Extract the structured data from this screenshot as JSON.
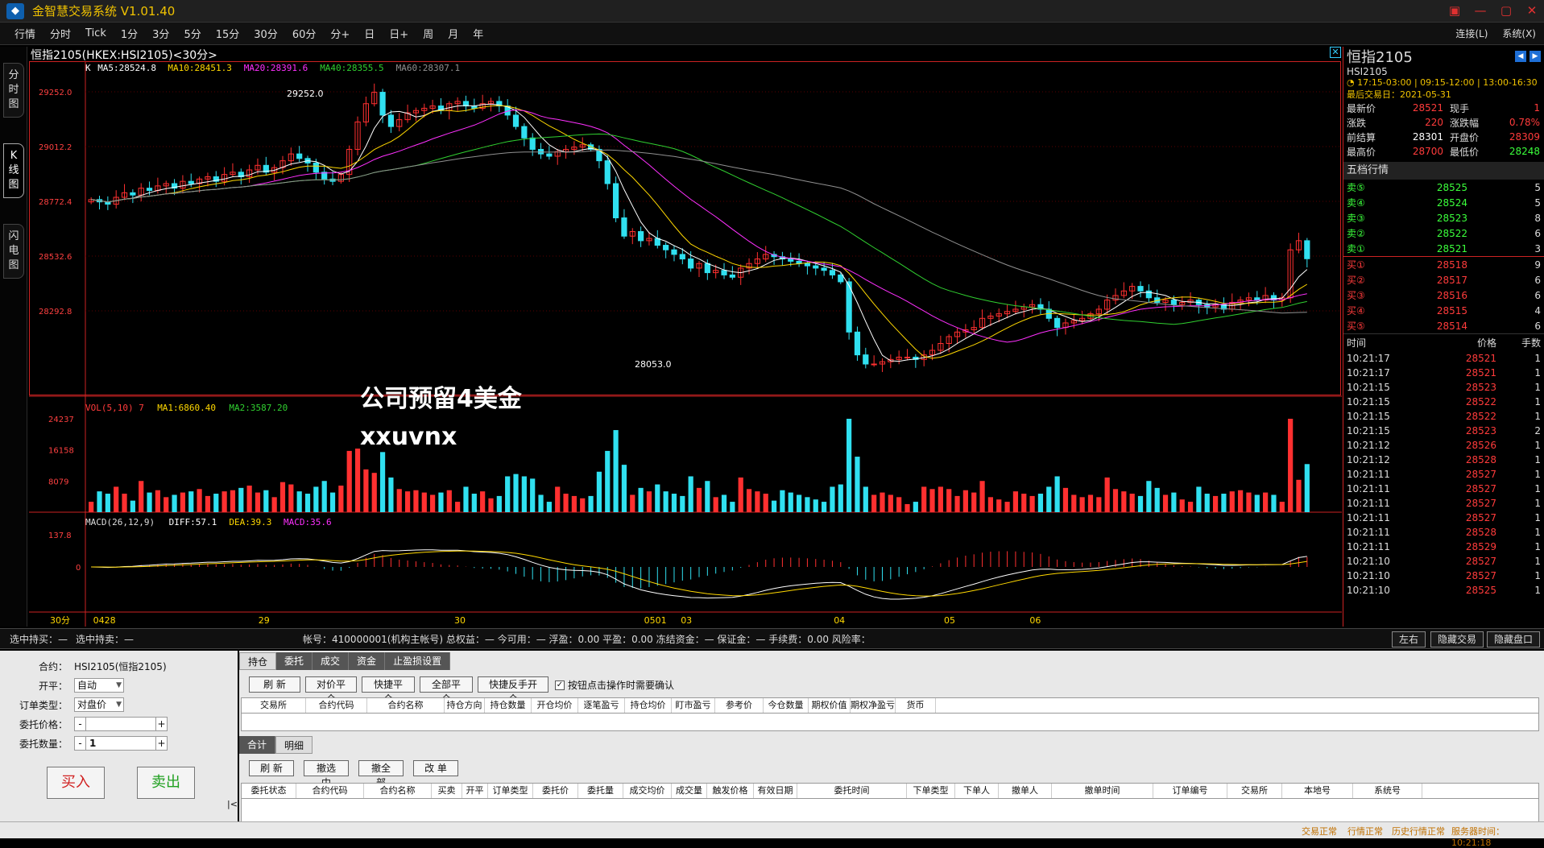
{
  "app": {
    "title": "金智慧交易系统",
    "version": "V1.01.40"
  },
  "menu": [
    "行情",
    "分时",
    "Tick",
    "1分",
    "3分",
    "5分",
    "15分",
    "30分",
    "60分",
    "分+",
    "日",
    "日+",
    "周",
    "月",
    "年"
  ],
  "menu_right": {
    "connect": "连接(L)",
    "system": "系统(X)"
  },
  "side_tabs": [
    "分时图",
    "K线图",
    "闪电图"
  ],
  "chart": {
    "title": "恒指2105(HKEX:HSI2105)<30分>",
    "ma_legend": [
      {
        "label": "K",
        "color": "#ffffff"
      },
      {
        "label": "MA5:28524.8",
        "color": "#ffffff"
      },
      {
        "label": "MA10:28451.3",
        "color": "#ffd800"
      },
      {
        "label": "MA20:28391.6",
        "color": "#ff30ff"
      },
      {
        "label": "MA40:28355.5",
        "color": "#30d030"
      },
      {
        "label": "MA60:28307.1",
        "color": "#909090"
      }
    ],
    "price_ticks": [
      "29252.0",
      "29012.2",
      "28772.4",
      "28532.6",
      "28292.8"
    ],
    "high_label": "29252.0",
    "low_label": "28053.0",
    "vol_legend": [
      {
        "label": "VOL(5,10) 7",
        "color": "#ff3b3b"
      },
      {
        "label": "MA1:6860.40",
        "color": "#ffd800"
      },
      {
        "label": "MA2:3587.20",
        "color": "#30d030"
      }
    ],
    "vol_ticks": [
      "24237",
      "16158",
      "8079"
    ],
    "macd_legend": [
      {
        "label": "MACD(26,12,9)",
        "color": "#dddddd"
      },
      {
        "label": "DIFF:57.1",
        "color": "#ffffff"
      },
      {
        "label": "DEA:39.3",
        "color": "#ffd800"
      },
      {
        "label": "MACD:35.6",
        "color": "#ff30ff"
      }
    ],
    "macd_ticks": [
      "137.8",
      "0"
    ],
    "period_label": "30分",
    "x_labels": [
      "0428",
      "29",
      "30",
      "0501",
      "03",
      "04",
      "05",
      "06"
    ]
  },
  "watermark": {
    "line1": "公司预留4美金",
    "line2": "xxuvnx"
  },
  "quote": {
    "name": "恒指2105",
    "code": "HSI2105",
    "sessions": "17:15-03:00 | 09:15-12:00 | 13:00-16:30",
    "last_trade_day": "最后交易日：2021-05-31",
    "rows": [
      {
        "k1": "最新价",
        "v1": "28521",
        "c1": "red",
        "k2": "现手",
        "v2": "1",
        "c2": "red"
      },
      {
        "k1": "涨跌",
        "v1": "220",
        "c1": "red",
        "k2": "涨跌幅",
        "v2": "0.78%",
        "c2": "red"
      },
      {
        "k1": "前结算",
        "v1": "28301",
        "c1": "white",
        "k2": "开盘价",
        "v2": "28309",
        "c2": "red"
      },
      {
        "k1": "最高价",
        "v1": "28700",
        "c1": "red",
        "k2": "最低价",
        "v2": "28248",
        "c2": "green"
      }
    ],
    "book_title": "五档行情",
    "asks": [
      {
        "n": "卖⑤",
        "p": "28525",
        "q": "5"
      },
      {
        "n": "卖④",
        "p": "28524",
        "q": "5"
      },
      {
        "n": "卖③",
        "p": "28523",
        "q": "8"
      },
      {
        "n": "卖②",
        "p": "28522",
        "q": "6"
      },
      {
        "n": "卖①",
        "p": "28521",
        "q": "3"
      }
    ],
    "bids": [
      {
        "n": "买①",
        "p": "28518",
        "q": "9"
      },
      {
        "n": "买②",
        "p": "28517",
        "q": "6"
      },
      {
        "n": "买③",
        "p": "28516",
        "q": "6"
      },
      {
        "n": "买④",
        "p": "28515",
        "q": "4"
      },
      {
        "n": "买⑤",
        "p": "28514",
        "q": "6"
      }
    ],
    "ticks_head": {
      "t": "时间",
      "p": "价格",
      "q": "手数"
    },
    "ticks": [
      {
        "t": "10:21:17",
        "p": "28521",
        "q": "1"
      },
      {
        "t": "10:21:17",
        "p": "28521",
        "q": "1"
      },
      {
        "t": "10:21:15",
        "p": "28523",
        "q": "1"
      },
      {
        "t": "10:21:15",
        "p": "28522",
        "q": "1"
      },
      {
        "t": "10:21:15",
        "p": "28522",
        "q": "1"
      },
      {
        "t": "10:21:15",
        "p": "28523",
        "q": "2"
      },
      {
        "t": "10:21:12",
        "p": "28526",
        "q": "1"
      },
      {
        "t": "10:21:12",
        "p": "28528",
        "q": "1"
      },
      {
        "t": "10:21:11",
        "p": "28527",
        "q": "1"
      },
      {
        "t": "10:21:11",
        "p": "28527",
        "q": "1"
      },
      {
        "t": "10:21:11",
        "p": "28527",
        "q": "1"
      },
      {
        "t": "10:21:11",
        "p": "28527",
        "q": "1"
      },
      {
        "t": "10:21:11",
        "p": "28528",
        "q": "1"
      },
      {
        "t": "10:21:11",
        "p": "28529",
        "q": "1"
      },
      {
        "t": "10:21:10",
        "p": "28527",
        "q": "1"
      },
      {
        "t": "10:21:10",
        "p": "28527",
        "q": "1"
      },
      {
        "t": "10:21:10",
        "p": "28525",
        "q": "1"
      }
    ]
  },
  "status": {
    "left1": "选中持买：—",
    "left2": "选中持卖：—",
    "account": "帐号：410000001(机构主帐号) 总权益：— 今可用：— 浮盈：0.00 平盈：0.00 冻结资金：— 保证金：— 手续费：0.00 风险率：",
    "btn_lr": "左右",
    "btn_hide_trade": "隐藏交易",
    "btn_hide_quote": "隐藏盘口"
  },
  "order": {
    "contract_label": "合约：",
    "contract_value": "HSI2105(恒指2105)",
    "open_label": "开平：",
    "open_value": "自动",
    "type_label": "订单类型：",
    "type_value": "对盘价",
    "price_label": "委托价格：",
    "price_value": "",
    "qty_label": "委托数量：",
    "qty_value": "1",
    "buy": "买入",
    "sell": "卖出",
    "collapse": "|<"
  },
  "trade": {
    "tabs": [
      "持仓",
      "委托",
      "成交",
      "资金",
      "止盈损设置"
    ],
    "pos_buttons": [
      "刷 新",
      "对价平仓",
      "快捷平仓",
      "全部平仓",
      "快捷反手开仓"
    ],
    "confirm_label": "按钮点击操作时需要确认",
    "pos_columns": [
      "交易所",
      "合约代码",
      "合约名称",
      "持仓方向",
      "持仓数量",
      "开仓均价",
      "逐笔盈亏",
      "持仓均价",
      "盯市盈亏",
      "参考价",
      "今仓数量",
      "期权价值",
      "期权净盈亏",
      "货币"
    ],
    "sub_tabs": [
      "合计",
      "明细"
    ],
    "order_buttons": [
      "刷 新",
      "撤选中",
      "撤全部",
      "改 单"
    ],
    "order_columns": [
      "委托状态",
      "合约代码",
      "合约名称",
      "买卖",
      "开平",
      "订单类型",
      "委托价",
      "委托量",
      "成交均价",
      "成交量",
      "触发价格",
      "有效日期",
      "委托时间",
      "下单类型",
      "下单人",
      "撤单人",
      "撤单时间",
      "订单编号",
      "交易所",
      "本地号",
      "系统号"
    ]
  },
  "bottom": {
    "s1": "交易正常",
    "s2": "行情正常",
    "s3": "历史行情正常",
    "s4": "服务器时间：10:21:18"
  },
  "chart_data": {
    "type": "candlestick",
    "period": "30分",
    "price_axis": [
      28292.8,
      28532.6,
      28772.4,
      29012.2,
      29252.0
    ],
    "closes": [
      28780,
      28770,
      28760,
      28790,
      28810,
      28800,
      28830,
      28820,
      28840,
      28850,
      28830,
      28860,
      28850,
      28870,
      28880,
      28860,
      28890,
      28900,
      28880,
      28910,
      28930,
      28900,
      28920,
      28950,
      28980,
      28960,
      28940,
      28900,
      28870,
      28860,
      28890,
      29000,
      29120,
      29200,
      29250,
      29150,
      29100,
      29130,
      29160,
      29170,
      29180,
      29190,
      29170,
      29200,
      29210,
      29190,
      29180,
      29200,
      29210,
      29190,
      29150,
      29100,
      29050,
      29000,
      28980,
      28970,
      28990,
      29000,
      29010,
      29020,
      29000,
      28950,
      28850,
      28700,
      28620,
      28640,
      28600,
      28610,
      28580,
      28560,
      28540,
      28520,
      28480,
      28500,
      28460,
      28470,
      28450,
      28440,
      28480,
      28500,
      28520,
      28540,
      28530,
      28520,
      28510,
      28500,
      28490,
      28480,
      28470,
      28450,
      28420,
      28200,
      28100,
      28060,
      28060,
      28070,
      28080,
      28090,
      28090,
      28080,
      28100,
      28120,
      28150,
      28180,
      28200,
      28210,
      28220,
      28260,
      28270,
      28280,
      28290,
      28300,
      28310,
      28320,
      28300,
      28260,
      28220,
      28240,
      28250,
      28260,
      28280,
      28300,
      28340,
      28360,
      28380,
      28400,
      28380,
      28350,
      28330,
      28340,
      28320,
      28330,
      28340,
      28320,
      28310,
      28320,
      28300,
      28330,
      28340,
      28350,
      28340,
      28360,
      28340,
      28350,
      28560,
      28600,
      28521
    ],
    "volume_max": 24237,
    "macd_max": 137.8
  }
}
